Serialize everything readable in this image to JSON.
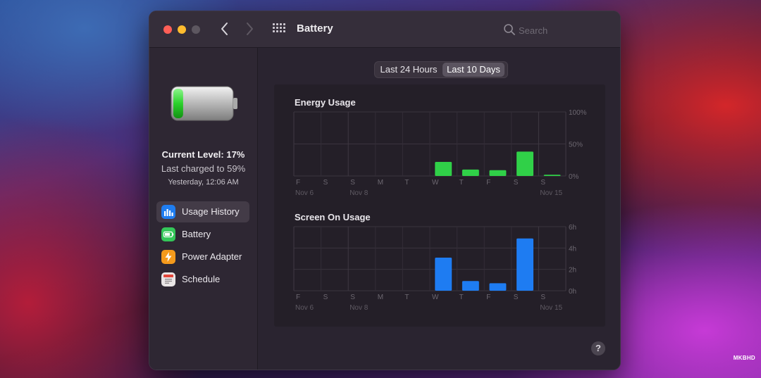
{
  "window": {
    "title": "Battery"
  },
  "search": {
    "placeholder": "Search"
  },
  "sidebar": {
    "current_level": "Current Level: 17%",
    "last_charged": "Last charged to 59%",
    "charged_time": "Yesterday, 12:06 AM",
    "battery_level_fraction": 0.17,
    "items": [
      {
        "label": "Usage History",
        "icon": "bar-chart-icon",
        "color": "#1f7df0",
        "selected": true
      },
      {
        "label": "Battery",
        "icon": "battery-icon",
        "color": "#34c759",
        "selected": false
      },
      {
        "label": "Power Adapter",
        "icon": "lightning-icon",
        "color": "#f59a1c",
        "selected": false
      },
      {
        "label": "Schedule",
        "icon": "calendar-icon",
        "color": "#e9e5e6",
        "selected": false
      }
    ]
  },
  "tabs": [
    {
      "label": "Last 24 Hours",
      "selected": false
    },
    {
      "label": "Last 10 Days",
      "selected": true
    }
  ],
  "colors": {
    "energy_bar": "#30d048",
    "screen_bar": "#1e7cf2",
    "accent": "#1e7cf2"
  },
  "chart_data": [
    {
      "type": "bar",
      "title": "Energy Usage",
      "categories": [
        "F",
        "S",
        "S",
        "M",
        "T",
        "W",
        "T",
        "F",
        "S",
        "S"
      ],
      "date_labels": [
        {
          "text": "Nov 6",
          "index": 0
        },
        {
          "text": "Nov 8",
          "index": 2
        },
        {
          "text": "Nov 15",
          "index": 9
        }
      ],
      "y_ticks": [
        "100%",
        "50%",
        "0%"
      ],
      "ylim": [
        0,
        100
      ],
      "values": [
        0,
        0,
        0,
        0,
        0,
        22,
        10,
        9,
        38,
        2
      ],
      "grid": true
    },
    {
      "type": "bar",
      "title": "Screen On Usage",
      "categories": [
        "F",
        "S",
        "S",
        "M",
        "T",
        "W",
        "T",
        "F",
        "S",
        "S"
      ],
      "date_labels": [
        {
          "text": "Nov 6",
          "index": 0
        },
        {
          "text": "Nov 8",
          "index": 2
        },
        {
          "text": "Nov 15",
          "index": 9
        }
      ],
      "y_ticks": [
        "6h",
        "4h",
        "2h",
        "0h"
      ],
      "ylim": [
        0,
        6
      ],
      "values": [
        0,
        0,
        0,
        0,
        0,
        3.1,
        0.9,
        0.7,
        4.9,
        0
      ],
      "grid": true
    }
  ],
  "help_label": "?",
  "watermark": "MKBHD"
}
